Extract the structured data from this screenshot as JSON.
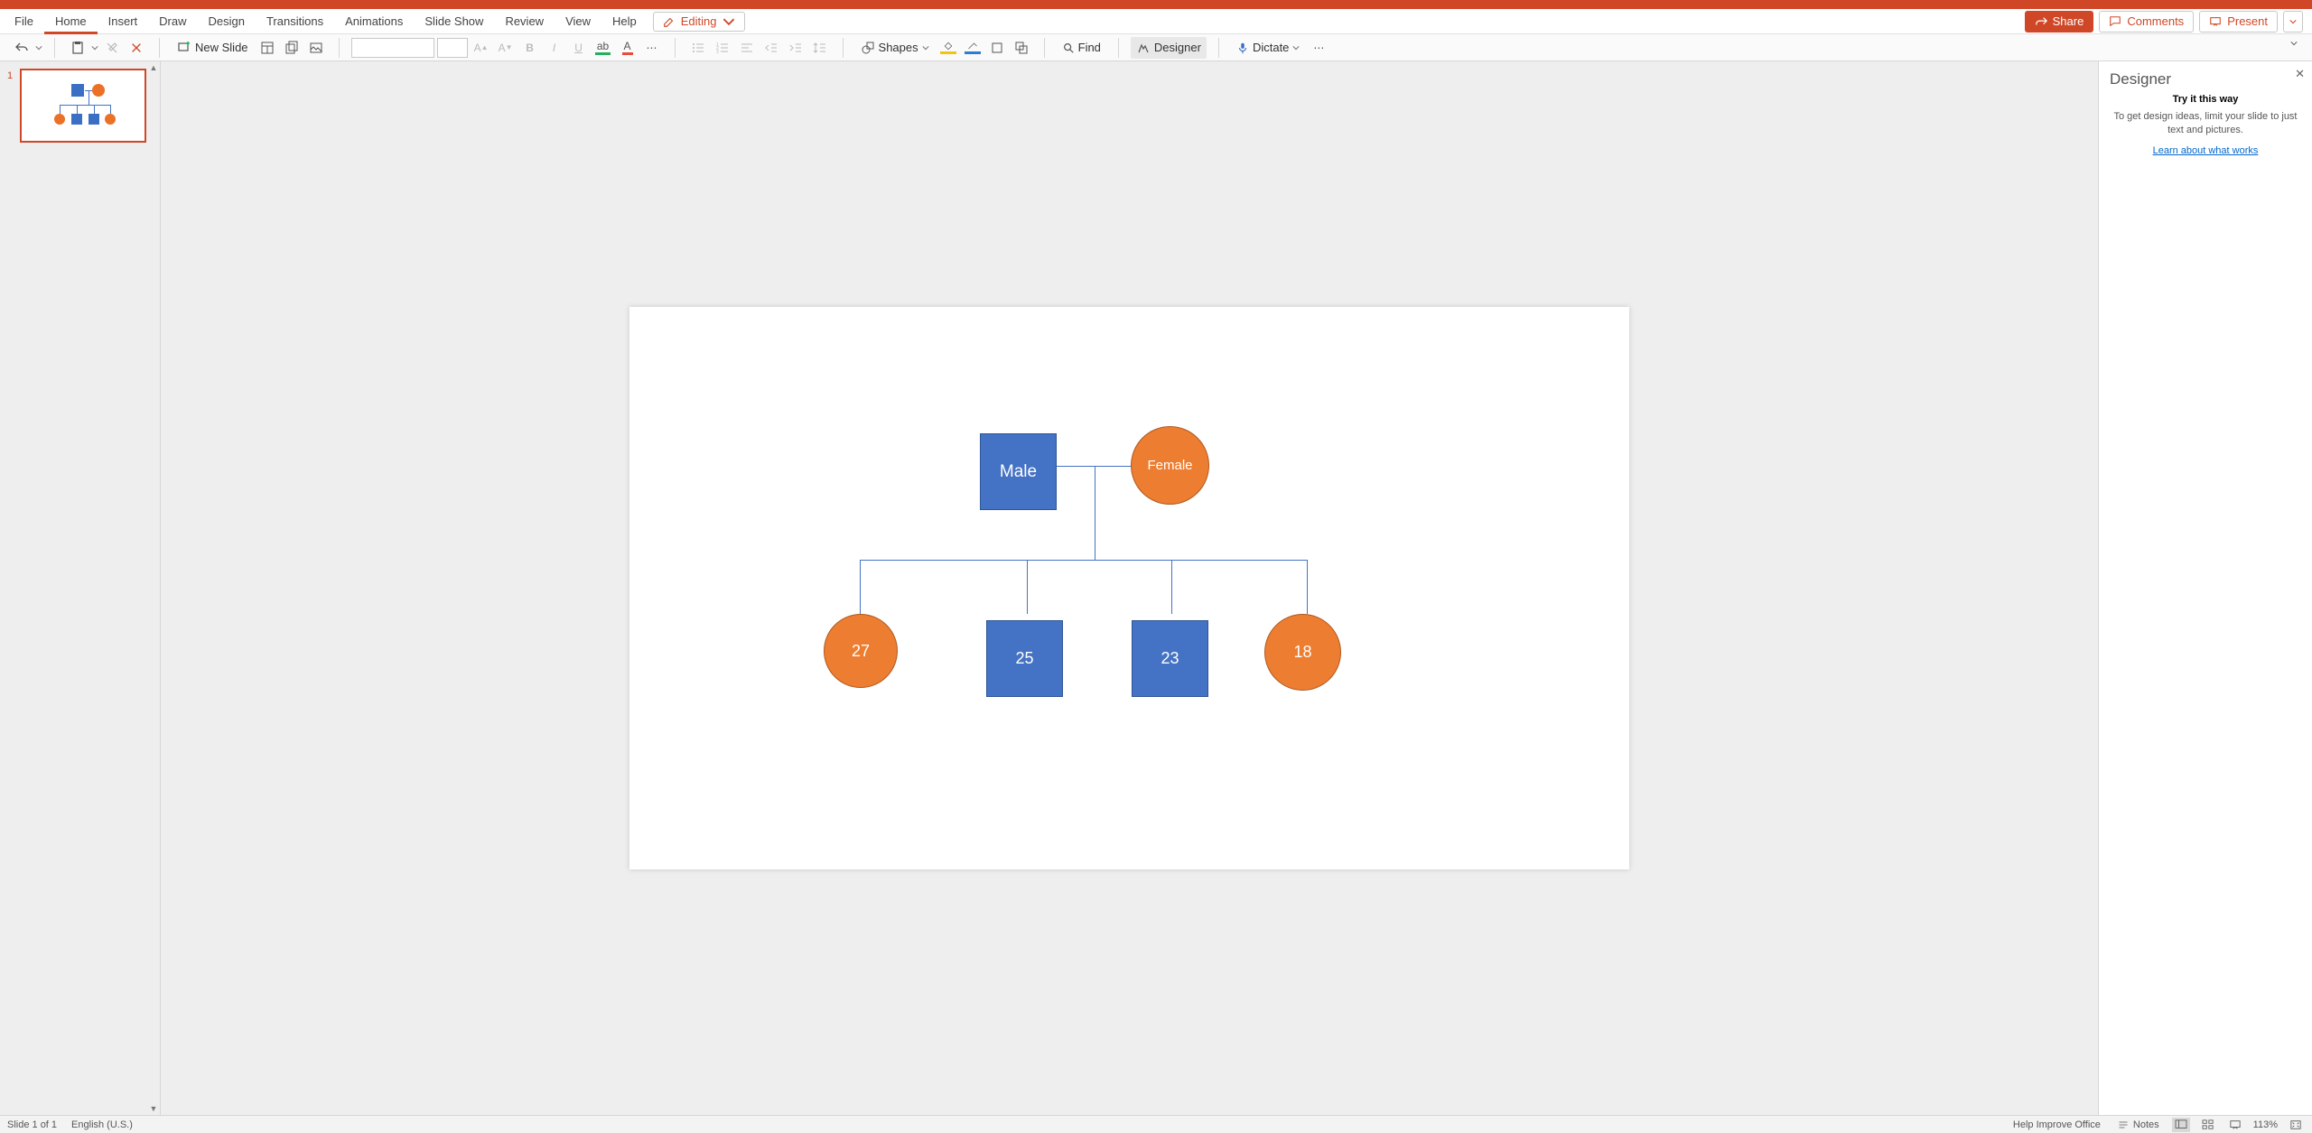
{
  "tabs": {
    "file": "File",
    "home": "Home",
    "insert": "Insert",
    "draw": "Draw",
    "design": "Design",
    "transitions": "Transitions",
    "animations": "Animations",
    "slideshow": "Slide Show",
    "review": "Review",
    "view": "View",
    "help": "Help"
  },
  "editing_mode": "Editing",
  "right_btns": {
    "share": "Share",
    "comments": "Comments",
    "present": "Present"
  },
  "ribbon": {
    "new_slide": "New Slide",
    "shapes": "Shapes",
    "find": "Find",
    "designer": "Designer",
    "dictate": "Dictate"
  },
  "slide_shapes": {
    "male": "Male",
    "female": "Female",
    "c1": "27",
    "c2": "25",
    "c3": "23",
    "c4": "18"
  },
  "thumb_number": "1",
  "designer_pane": {
    "title": "Designer",
    "try": "Try it this way",
    "text": "To get design ideas, limit your slide to just text and pictures.",
    "link": "Learn about what works"
  },
  "status": {
    "slide": "Slide 1 of 1",
    "lang": "English (U.S.)",
    "help": "Help Improve Office",
    "notes": "Notes",
    "zoom": "113%"
  }
}
